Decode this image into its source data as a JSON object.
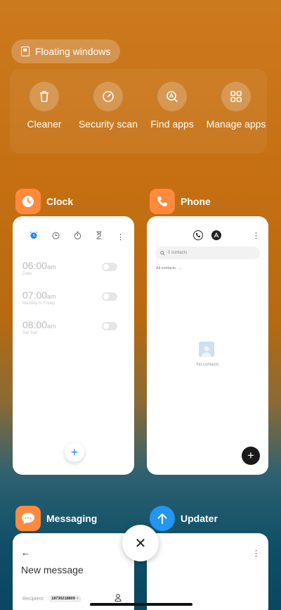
{
  "floating_windows": {
    "label": "Floating windows"
  },
  "tools": [
    {
      "label": "Cleaner",
      "icon": "trash-icon"
    },
    {
      "label": "Security scan",
      "icon": "security-gauge-icon"
    },
    {
      "label": "Find apps",
      "icon": "find-apps-icon"
    },
    {
      "label": "Manage apps",
      "icon": "grid-icon"
    }
  ],
  "apps": {
    "clock": {
      "name": "Clock",
      "icon_color": "#ff8a3d",
      "alarms": [
        {
          "time": "06:00",
          "ampm": "am",
          "repeat": "Daily"
        },
        {
          "time": "07:00",
          "ampm": "am",
          "repeat": "Monday to Friday"
        },
        {
          "time": "08:00",
          "ampm": "am",
          "repeat": "Sat Sun"
        }
      ],
      "add_label": "+"
    },
    "phone": {
      "name": "Phone",
      "icon_color": "#ff8a3d",
      "search_placeholder": "0 contacts",
      "filter_label": "All contacts",
      "empty_label": "No contacts",
      "add_label": "+"
    },
    "messaging": {
      "name": "Messaging",
      "icon_color": "#ff8a3d",
      "back_label": "←",
      "title": "New message",
      "recipient_label": "Recipient:",
      "recipient_value": "18730218809"
    },
    "updater": {
      "name": "Updater",
      "icon_color": "#2196f3"
    }
  },
  "close_label": "✕",
  "more_label": "⋮"
}
